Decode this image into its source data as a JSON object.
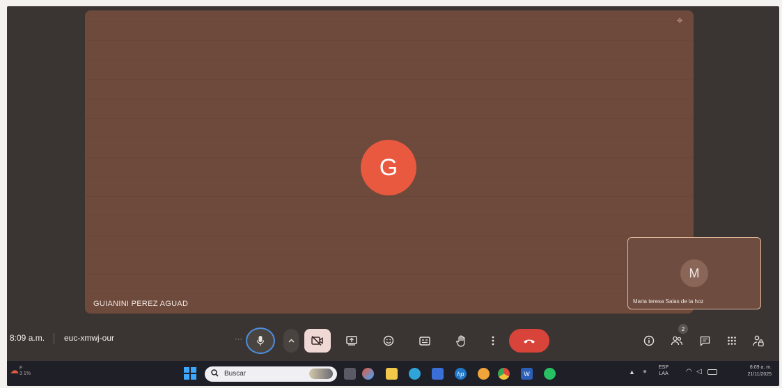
{
  "main_participant": {
    "initial": "G",
    "name": "GUIANINI PEREZ AGUAD"
  },
  "self_participant": {
    "initial": "M",
    "name": "Maria teresa Salas de la hoz"
  },
  "meeting": {
    "time": "8:09 a.m.",
    "code": "euc-xmwj-our",
    "people_count": "2"
  },
  "controls": {
    "mic_dots": "⋯",
    "icons": [
      "mic-icon",
      "chevron-up-icon",
      "camera-off-icon",
      "present-icon",
      "emoji-icon",
      "captions-icon",
      "raise-hand-icon",
      "more-vert-icon",
      "end-call-icon",
      "info-icon",
      "people-icon",
      "chat-icon",
      "activities-icon",
      "host-controls-icon"
    ]
  },
  "taskbar": {
    "search_placeholder": "Buscar",
    "weather_text": "F",
    "weather_sub": "3 1%",
    "lang": "ESP",
    "lang_sub": "LAA",
    "time": "8:09 a. m.",
    "date": "21/11/2025"
  },
  "colors": {
    "tile_bg": "#6e4a3c",
    "main_avatar": "#e8593f",
    "self_avatar": "#8a6659",
    "self_border": "#e0b79a",
    "mic_ring": "#4d8fe0",
    "camera_bg": "#f0d9d5",
    "leave_button": "#d9443a",
    "control_bar": "#3a3533",
    "taskbar": "#1f1f27"
  }
}
